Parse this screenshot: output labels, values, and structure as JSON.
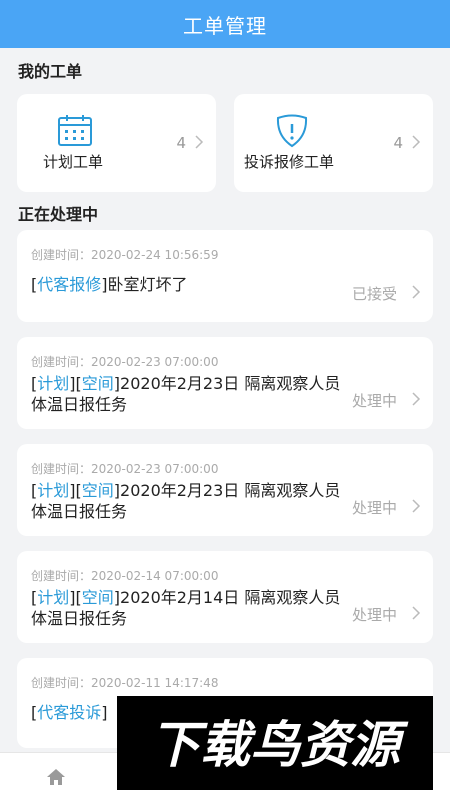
{
  "header": {
    "title": "工单管理"
  },
  "my_orders": {
    "section_title": "我的工单",
    "cards": [
      {
        "label": "计划工单",
        "count": "4",
        "icon": "calendar-icon"
      },
      {
        "label": "投诉报修工单",
        "count": "4",
        "icon": "shield-alert-icon"
      }
    ]
  },
  "processing": {
    "section_title": "正在处理中",
    "orders": [
      {
        "time": "创建时间：2020-02-24 10:56:59",
        "tags": [
          "代客报修"
        ],
        "title": "卧室灯坏了",
        "status": "已接受"
      },
      {
        "time": "创建时间：2020-02-23 07:00:00",
        "tags": [
          "计划",
          "空间"
        ],
        "title": "2020年2月23日 隔离观察人员体温日报任务",
        "status": "处理中"
      },
      {
        "time": "创建时间：2020-02-23 07:00:00",
        "tags": [
          "计划",
          "空间"
        ],
        "title": "2020年2月23日 隔离观察人员体温日报任务",
        "status": "处理中"
      },
      {
        "time": "创建时间：2020-02-14 07:00:00",
        "tags": [
          "计划",
          "空间"
        ],
        "title": "2020年2月14日 隔离观察人员体温日报任务",
        "status": "处理中"
      },
      {
        "time": "创建时间：2020-02-11 14:17:48",
        "tags": [
          "代客投诉"
        ],
        "title": "",
        "status": ""
      }
    ]
  },
  "tabbar": {
    "home_icon": "home-icon"
  },
  "watermark": {
    "text": "下载鸟资源"
  },
  "colors": {
    "header": "#4aa5f5",
    "tag": "#2a9ad8",
    "muted": "#aaaaaa"
  }
}
